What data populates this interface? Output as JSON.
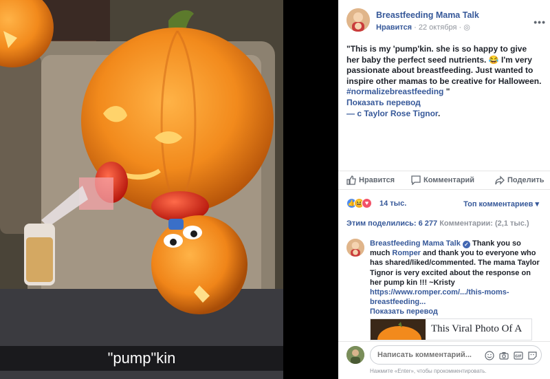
{
  "photo": {
    "caption": "\"pump\"kin"
  },
  "post": {
    "page_name": "Breastfeeding Mama Talk",
    "like_label": "Нравится",
    "date": "22 октября",
    "separator": "·",
    "text_main": "\"This is my 'pump'kin. she is so happy to give her baby the perfect seed nutrients. 😂 I'm very passionate about breastfeeding. Just wanted to inspire other mamas to be creative for Halloween.",
    "hashtag": "#normalizebreastfeeding",
    "quote_close": "\"",
    "translate": "Показать перевод",
    "with_prefix": "— с",
    "tagged_person": "Taylor Rose Tignor",
    "period": "."
  },
  "actions": {
    "like": "Нравится",
    "comment": "Комментарий",
    "share": "Поделить"
  },
  "reactions": {
    "count": "14 тыс.",
    "top_comments": "Топ комментариев",
    "icons": [
      "like-reaction",
      "haha-reaction",
      "love-reaction"
    ],
    "colors": {
      "like": "#4a8af4",
      "haha": "#f7b125",
      "love": "#f25268"
    }
  },
  "shares": {
    "shared_label": "Этим поделились:",
    "shared_count": "6 277",
    "comments_label": "Комментарии:",
    "comments_count": "(2,1 тыс.)"
  },
  "comment": {
    "author": "Breastfeeding Mama Talk",
    "text_before": "Thank you so much",
    "mention": "Romper",
    "text_after": "and thank you to everyone who has shared/liked/commented. The mama Taylor Tignor is very excited about the response on her pump kin !!! ~Kristy",
    "url": "https://www.romper.com/.../this-moms-breastfeeding...",
    "translate": "Показать перевод",
    "link_title": "This Viral Photo Of A"
  },
  "composer": {
    "placeholder": "Написать комментарий...",
    "hint": "Нажмите «Enter», чтобы прокомментировать."
  },
  "colors": {
    "link": "#365899",
    "meta": "#90949c",
    "pumpkin": "#f28a1c",
    "background_photo": "#000000"
  }
}
